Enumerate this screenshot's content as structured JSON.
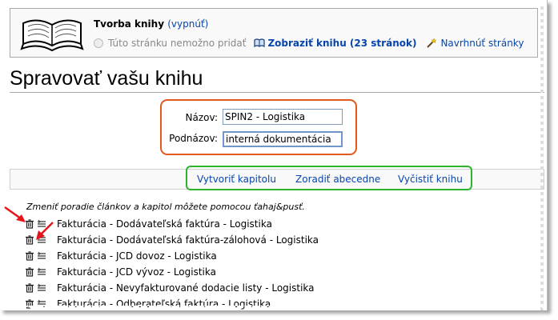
{
  "banner": {
    "title": "Tvorba knihy",
    "toggle": "(vypnúť)",
    "cannot_add": "Túto stránku nemožno pridať",
    "view_book": "Zobraziť knihu (23 stránok)",
    "suggest": "Navrhnúť stránky"
  },
  "page_title": "Spravovať vašu knihu",
  "form": {
    "title_label": "Názov:",
    "title_value": "SPIN2 - Logistika",
    "subtitle_label": "Podnázov:",
    "subtitle_value": "interná dokumentácia"
  },
  "toolbar": {
    "create_chapter": "Vytvoriť kapitolu",
    "sort": "Zoradiť abecedne",
    "clear": "Vyčistiť knihu"
  },
  "hint": "Zmeniť poradie článkov a kapitol môžete pomocou ťahaj&pusť.",
  "items": [
    "Fakturácia - Dodávateľská faktúra - Logistika",
    "Fakturácia - Dodávateľská faktúra-zálohová - Logistika",
    "Fakturácia - JCD dovoz - Logistika",
    "Fakturácia - JCD vývoz - Logistika",
    "Fakturácia - Nevyfakturované dodacie listy - Logistika",
    "Fakturácia - Odberateľská faktúra - Logistika"
  ],
  "colors": {
    "link": "#0645ad",
    "highlight_red": "#e05a1e",
    "highlight_green": "#2cb52c",
    "arrow": "#e8141c"
  },
  "icons": [
    "book-icon",
    "radio-icon",
    "small-book-icon",
    "wand-icon",
    "trash-icon",
    "drag-handle-icon",
    "arrow-icon"
  ]
}
